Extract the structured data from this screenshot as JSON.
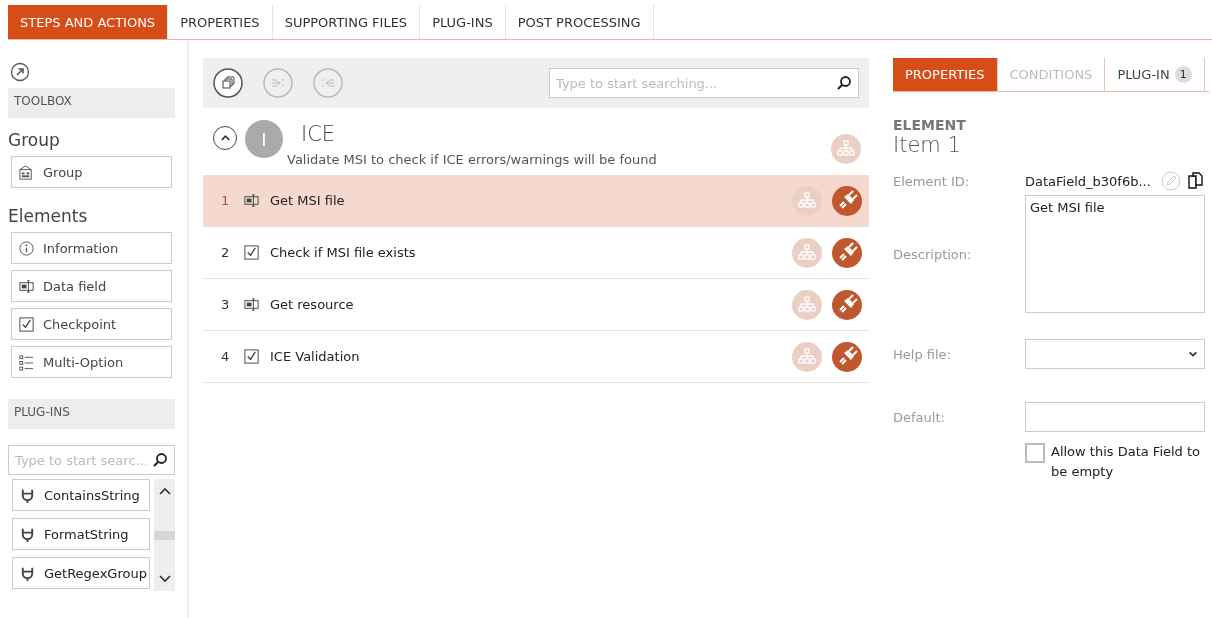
{
  "top_tabs": [
    {
      "label": "STEPS AND ACTIONS",
      "selected": true
    },
    {
      "label": "PROPERTIES",
      "selected": false
    },
    {
      "label": "SUPPORTING FILES",
      "selected": false
    },
    {
      "label": "PLUG-INS",
      "selected": false
    },
    {
      "label": "POST PROCESSING",
      "selected": false
    }
  ],
  "toolbox": {
    "title": "TOOLBOX",
    "sections": [
      {
        "heading": "Group",
        "items": [
          {
            "label": "Group",
            "kind": "group"
          }
        ]
      },
      {
        "heading": "Elements",
        "items": [
          {
            "label": "Information",
            "kind": "info"
          },
          {
            "label": "Data field",
            "kind": "datafield"
          },
          {
            "label": "Checkpoint",
            "kind": "checkpoint"
          },
          {
            "label": "Multi-Option",
            "kind": "multi"
          }
        ]
      }
    ]
  },
  "plugins": {
    "title": "PLUG-INS",
    "search_placeholder": "Type to start searc...",
    "items": [
      "ContainsString",
      "FormatString",
      "GetRegexGroup"
    ]
  },
  "steps": {
    "search_placeholder": "Type to start searching...",
    "group": {
      "letter": "I",
      "title": "ICE",
      "description": "Validate MSI to check if ICE errors/warnings will be found",
      "expanded": true
    },
    "items": [
      {
        "number": "1",
        "label": "Get MSI file",
        "kind": "datafield",
        "selected": true
      },
      {
        "number": "2",
        "label": "Check if MSI file exists",
        "kind": "checkpoint",
        "selected": false
      },
      {
        "number": "3",
        "label": "Get resource",
        "kind": "datafield",
        "selected": false
      },
      {
        "number": "4",
        "label": "ICE Validation",
        "kind": "checkpoint",
        "selected": false
      }
    ]
  },
  "props": {
    "tabs": [
      {
        "label": "PROPERTIES",
        "selected": true
      },
      {
        "label": "CONDITIONS",
        "selected": false
      },
      {
        "label": "PLUG-IN",
        "badge": "1",
        "selected": false
      }
    ],
    "heading": "ELEMENT",
    "item_title": "Item  1",
    "element_id_label": "Element ID:",
    "element_id": "DataField_b30f6b...",
    "description_label": "Description:",
    "description": "Get MSI file",
    "help_file_label": "Help file:",
    "default_label": "Default:",
    "allow_empty": {
      "label": "Allow this Data Field to be empty",
      "checked": false
    }
  }
}
